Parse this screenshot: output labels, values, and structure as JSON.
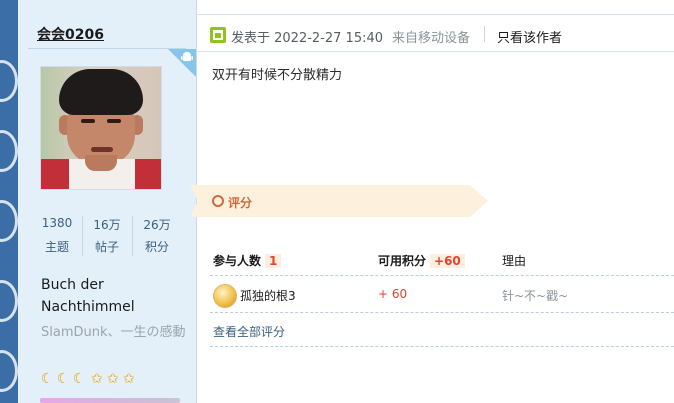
{
  "author": {
    "name": "会会0206",
    "stats": [
      {
        "value": "1380",
        "label": "主题"
      },
      {
        "value": "16万",
        "label": "帖子"
      },
      {
        "value": "26万",
        "label": "积分"
      }
    ],
    "signature": "Buch der Nachthimmel",
    "motto": "SlamDunk、一生の感動",
    "medals": [
      "moon",
      "moon",
      "moon",
      "star",
      "star",
      "star"
    ]
  },
  "post": {
    "meta": "发表于 2022-2-27 15:40",
    "device": "来自移动设备",
    "only_author": "只看该作者",
    "body": "双开有时候不分散精力"
  },
  "rating": {
    "title": "评分",
    "participants_label": "参与人数",
    "participants_count": "1",
    "points_label": "可用积分",
    "points_total": "+60",
    "reason_label": "理由",
    "entries": [
      {
        "user": "孤独的根3",
        "score": "+ 60",
        "reason": "针~不~戳~"
      }
    ],
    "view_all": "查看全部评分"
  },
  "colors": {
    "author_panel_bg": "#e4f0f9",
    "accent_orange": "#d06a3e",
    "score_red": "#e2432b",
    "link_blue": "#3b5f7d"
  }
}
